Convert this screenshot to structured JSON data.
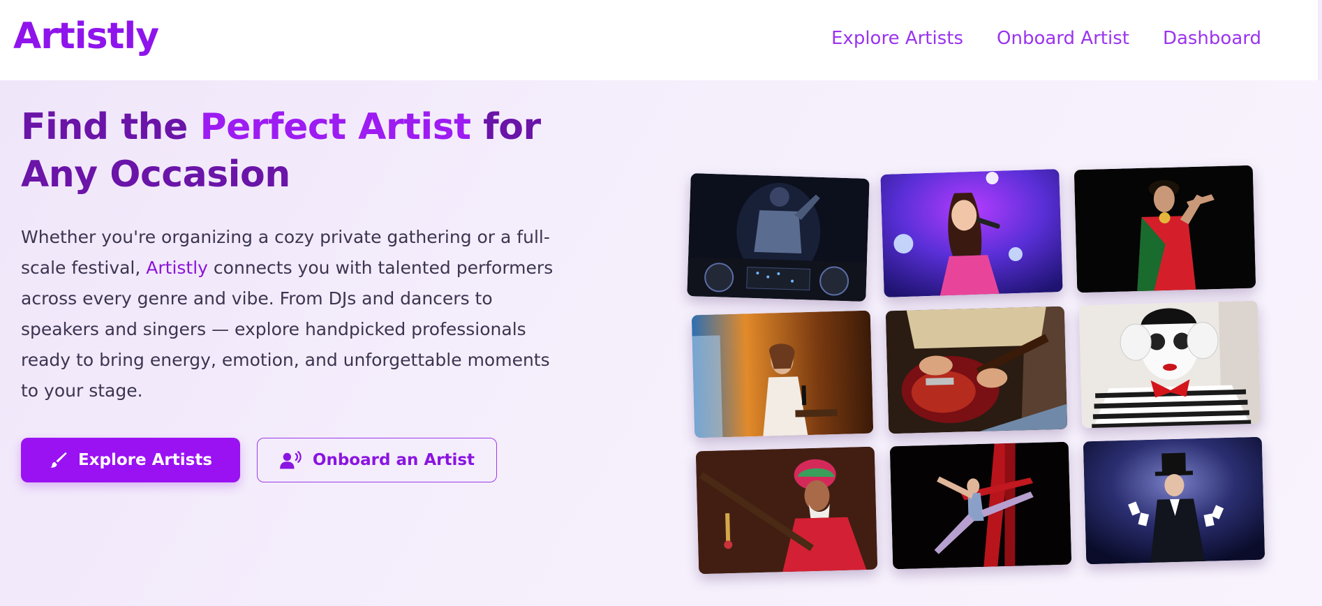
{
  "header": {
    "brand": "Artistly",
    "nav": {
      "explore": "Explore Artists",
      "onboard": "Onboard Artist",
      "dashboard": "Dashboard"
    }
  },
  "hero": {
    "headline": {
      "part1": "Find the ",
      "accent": "Perfect Artist",
      "part2": " for Any Occasion"
    },
    "description": {
      "before": "Whether you're organizing a cozy private gathering or a full-scale festival, ",
      "brand": "Artistly",
      "after": " connects you with talented performers across every genre and vibe. From DJs and dancers to speakers and singers — explore handpicked professionals ready to bring energy, emotion, and unforgettable moments to your stage."
    },
    "buttons": {
      "explore": "Explore Artists",
      "onboard": "Onboard an Artist"
    }
  },
  "collage": [
    {
      "name": "dj-photo",
      "subject": "DJ at turntables"
    },
    {
      "name": "singer-photo",
      "subject": "Singer with microphone on stage"
    },
    {
      "name": "classical-dancer-photo",
      "subject": "Classical Indian dancer"
    },
    {
      "name": "speaker-photo",
      "subject": "Speaker at podium"
    },
    {
      "name": "guitarist-photo",
      "subject": "Electric guitar player"
    },
    {
      "name": "mime-photo",
      "subject": "Mime artist"
    },
    {
      "name": "folk-musician-photo",
      "subject": "Folk musician with string instrument"
    },
    {
      "name": "aerialist-photo",
      "subject": "Aerial silk performer"
    },
    {
      "name": "magician-photo",
      "subject": "Magician with cards"
    }
  ],
  "colors": {
    "brand": "#8f14ec",
    "accent": "#9d1cf2",
    "headline": "#6a14a8",
    "button_primary": "#9a12f2"
  },
  "icons": {
    "explore_button": "paintbrush-icon",
    "onboard_button": "user-voice-icon"
  }
}
